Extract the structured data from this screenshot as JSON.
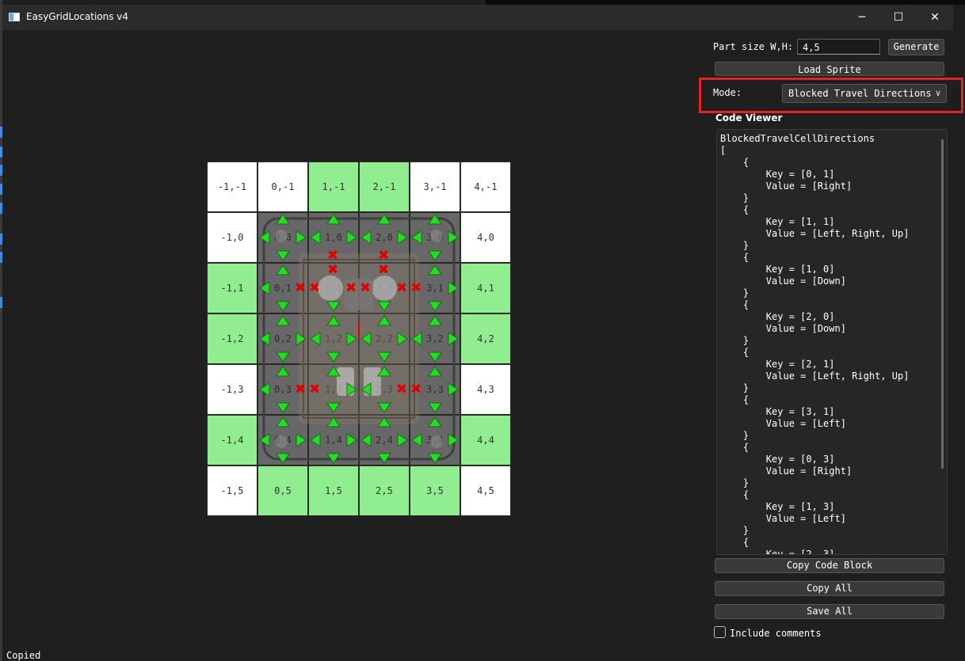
{
  "window": {
    "title": "EasyGridLocations v4",
    "minimize": "─",
    "maximize": "☐",
    "close": "✕"
  },
  "grid": {
    "rows": [
      [
        {
          "label": "-1,-1",
          "type": "white"
        },
        {
          "label": "0,-1",
          "type": "white"
        },
        {
          "label": "1,-1",
          "type": "green"
        },
        {
          "label": "2,-1",
          "type": "green"
        },
        {
          "label": "3,-1",
          "type": "white"
        },
        {
          "label": "4,-1",
          "type": "white"
        }
      ],
      [
        {
          "label": "-1,0",
          "type": "white"
        },
        {
          "label": "0,0",
          "type": "sprite"
        },
        {
          "label": "1,0",
          "type": "sprite"
        },
        {
          "label": "2,0",
          "type": "sprite"
        },
        {
          "label": "3,0",
          "type": "sprite"
        },
        {
          "label": "4,0",
          "type": "white"
        }
      ],
      [
        {
          "label": "-1,1",
          "type": "green"
        },
        {
          "label": "0,1",
          "type": "sprite"
        },
        {
          "label": "1,1",
          "type": "sprite"
        },
        {
          "label": "2,1",
          "type": "sprite"
        },
        {
          "label": "3,1",
          "type": "sprite"
        },
        {
          "label": "4,1",
          "type": "green"
        }
      ],
      [
        {
          "label": "-1,2",
          "type": "green"
        },
        {
          "label": "0,2",
          "type": "sprite"
        },
        {
          "label": "1,2",
          "type": "sprite"
        },
        {
          "label": "2,2",
          "type": "sprite"
        },
        {
          "label": "3,2",
          "type": "sprite"
        },
        {
          "label": "4,2",
          "type": "green"
        }
      ],
      [
        {
          "label": "-1,3",
          "type": "white"
        },
        {
          "label": "0,3",
          "type": "sprite"
        },
        {
          "label": "1,3",
          "type": "sprite"
        },
        {
          "label": "2,3",
          "type": "sprite"
        },
        {
          "label": "3,3",
          "type": "sprite"
        },
        {
          "label": "4,3",
          "type": "white"
        }
      ],
      [
        {
          "label": "-1,4",
          "type": "green"
        },
        {
          "label": "0,4",
          "type": "sprite"
        },
        {
          "label": "1,4",
          "type": "sprite"
        },
        {
          "label": "2,4",
          "type": "sprite"
        },
        {
          "label": "3,4",
          "type": "sprite"
        },
        {
          "label": "4,4",
          "type": "green"
        }
      ],
      [
        {
          "label": "-1,5",
          "type": "white"
        },
        {
          "label": "0,5",
          "type": "green"
        },
        {
          "label": "1,5",
          "type": "green"
        },
        {
          "label": "2,5",
          "type": "green"
        },
        {
          "label": "3,5",
          "type": "green"
        },
        {
          "label": "4,5",
          "type": "white"
        }
      ]
    ],
    "blocked": [
      {
        "cell": [
          0,
          1
        ],
        "dirs": [
          "Right"
        ]
      },
      {
        "cell": [
          1,
          1
        ],
        "dirs": [
          "Left",
          "Right",
          "Up"
        ]
      },
      {
        "cell": [
          1,
          0
        ],
        "dirs": [
          "Down"
        ]
      },
      {
        "cell": [
          2,
          0
        ],
        "dirs": [
          "Down"
        ]
      },
      {
        "cell": [
          2,
          1
        ],
        "dirs": [
          "Left",
          "Right",
          "Up"
        ]
      },
      {
        "cell": [
          3,
          1
        ],
        "dirs": [
          "Left"
        ]
      },
      {
        "cell": [
          0,
          3
        ],
        "dirs": [
          "Right"
        ]
      },
      {
        "cell": [
          1,
          3
        ],
        "dirs": [
          "Left"
        ]
      },
      {
        "cell": [
          2,
          3
        ],
        "dirs": [
          "Right"
        ]
      },
      {
        "cell": [
          3,
          3
        ],
        "dirs": [
          "Left"
        ]
      }
    ],
    "colors": {
      "open_arrow": "#22dd22",
      "blocked": "#e00000",
      "green_cell": "#90ee90"
    }
  },
  "controls": {
    "part_size_label": "Part size W,H:",
    "part_size_value": "4,5",
    "generate": "Generate",
    "load_sprite": "Load Sprite",
    "mode_label": "Mode:",
    "mode_value": "Blocked Travel Directions",
    "code_viewer_title": "Code Viewer",
    "code_text": "BlockedTravelCellDirections\n[\n    {\n        Key = [0, 1]\n        Value = [Right]\n    }\n    {\n        Key = [1, 1]\n        Value = [Left, Right, Up]\n    }\n    {\n        Key = [1, 0]\n        Value = [Down]\n    }\n    {\n        Key = [2, 0]\n        Value = [Down]\n    }\n    {\n        Key = [2, 1]\n        Value = [Left, Right, Up]\n    }\n    {\n        Key = [3, 1]\n        Value = [Left]\n    }\n    {\n        Key = [0, 3]\n        Value = [Right]\n    }\n    {\n        Key = [1, 3]\n        Value = [Left]\n    }\n    {\n        Key = [2, 3]",
    "copy_code_block": "Copy Code Block",
    "copy_all": "Copy All",
    "save_all": "Save All",
    "include_comments": "Include comments"
  },
  "status": "Copied"
}
